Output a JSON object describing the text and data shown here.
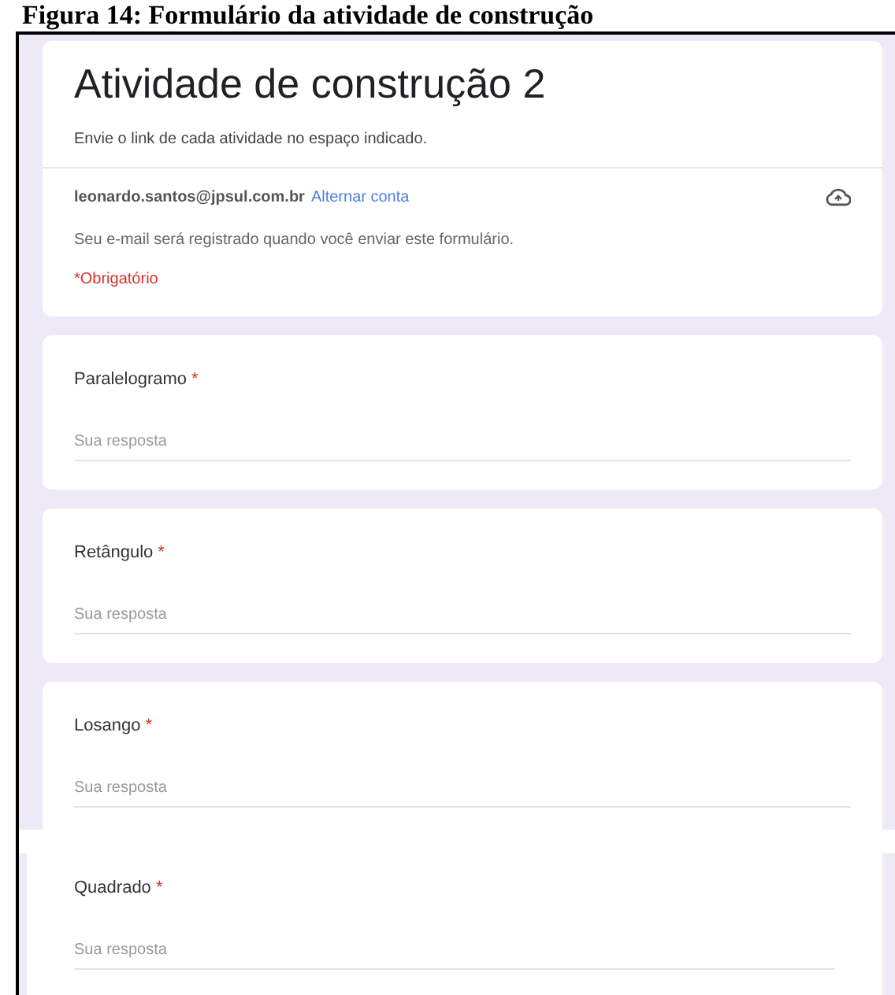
{
  "caption": "Figura 14: Formulário da atividade de construção",
  "form": {
    "title": "Atividade de construção 2",
    "description": "Envie o link de cada atividade no espaço indicado.",
    "account": {
      "email": "leonardo.santos@jpsul.com.br",
      "switch_link": "Alternar conta"
    },
    "notice": "Seu e-mail será registrado quando você enviar este formulário.",
    "required_note": "*Obrigatório"
  },
  "questions": [
    {
      "label": "Paralelogramo",
      "required_mark": "*",
      "placeholder": "Sua resposta"
    },
    {
      "label": "Retângulo",
      "required_mark": "*",
      "placeholder": "Sua resposta"
    },
    {
      "label": "Losango",
      "required_mark": "*",
      "placeholder": "Sua resposta"
    },
    {
      "label": "Quadrado",
      "required_mark": "*",
      "placeholder": "Sua resposta"
    }
  ]
}
